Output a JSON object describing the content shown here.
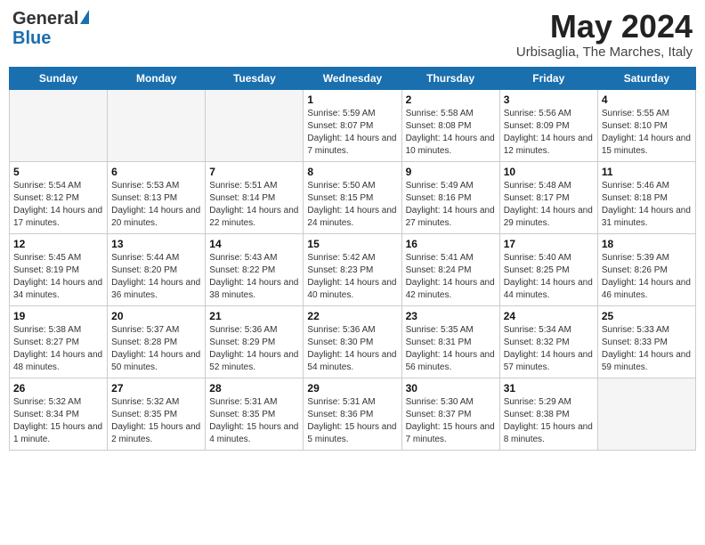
{
  "logo": {
    "general": "General",
    "blue": "Blue"
  },
  "title": {
    "month": "May 2024",
    "location": "Urbisaglia, The Marches, Italy"
  },
  "headers": [
    "Sunday",
    "Monday",
    "Tuesday",
    "Wednesday",
    "Thursday",
    "Friday",
    "Saturday"
  ],
  "weeks": [
    [
      {
        "day": "",
        "empty": true
      },
      {
        "day": "",
        "empty": true
      },
      {
        "day": "",
        "empty": true
      },
      {
        "day": "1",
        "sunrise": "5:59 AM",
        "sunset": "8:07 PM",
        "daylight": "14 hours and 7 minutes."
      },
      {
        "day": "2",
        "sunrise": "5:58 AM",
        "sunset": "8:08 PM",
        "daylight": "14 hours and 10 minutes."
      },
      {
        "day": "3",
        "sunrise": "5:56 AM",
        "sunset": "8:09 PM",
        "daylight": "14 hours and 12 minutes."
      },
      {
        "day": "4",
        "sunrise": "5:55 AM",
        "sunset": "8:10 PM",
        "daylight": "14 hours and 15 minutes."
      }
    ],
    [
      {
        "day": "5",
        "sunrise": "5:54 AM",
        "sunset": "8:12 PM",
        "daylight": "14 hours and 17 minutes."
      },
      {
        "day": "6",
        "sunrise": "5:53 AM",
        "sunset": "8:13 PM",
        "daylight": "14 hours and 20 minutes."
      },
      {
        "day": "7",
        "sunrise": "5:51 AM",
        "sunset": "8:14 PM",
        "daylight": "14 hours and 22 minutes."
      },
      {
        "day": "8",
        "sunrise": "5:50 AM",
        "sunset": "8:15 PM",
        "daylight": "14 hours and 24 minutes."
      },
      {
        "day": "9",
        "sunrise": "5:49 AM",
        "sunset": "8:16 PM",
        "daylight": "14 hours and 27 minutes."
      },
      {
        "day": "10",
        "sunrise": "5:48 AM",
        "sunset": "8:17 PM",
        "daylight": "14 hours and 29 minutes."
      },
      {
        "day": "11",
        "sunrise": "5:46 AM",
        "sunset": "8:18 PM",
        "daylight": "14 hours and 31 minutes."
      }
    ],
    [
      {
        "day": "12",
        "sunrise": "5:45 AM",
        "sunset": "8:19 PM",
        "daylight": "14 hours and 34 minutes."
      },
      {
        "day": "13",
        "sunrise": "5:44 AM",
        "sunset": "8:20 PM",
        "daylight": "14 hours and 36 minutes."
      },
      {
        "day": "14",
        "sunrise": "5:43 AM",
        "sunset": "8:22 PM",
        "daylight": "14 hours and 38 minutes."
      },
      {
        "day": "15",
        "sunrise": "5:42 AM",
        "sunset": "8:23 PM",
        "daylight": "14 hours and 40 minutes."
      },
      {
        "day": "16",
        "sunrise": "5:41 AM",
        "sunset": "8:24 PM",
        "daylight": "14 hours and 42 minutes."
      },
      {
        "day": "17",
        "sunrise": "5:40 AM",
        "sunset": "8:25 PM",
        "daylight": "14 hours and 44 minutes."
      },
      {
        "day": "18",
        "sunrise": "5:39 AM",
        "sunset": "8:26 PM",
        "daylight": "14 hours and 46 minutes."
      }
    ],
    [
      {
        "day": "19",
        "sunrise": "5:38 AM",
        "sunset": "8:27 PM",
        "daylight": "14 hours and 48 minutes."
      },
      {
        "day": "20",
        "sunrise": "5:37 AM",
        "sunset": "8:28 PM",
        "daylight": "14 hours and 50 minutes."
      },
      {
        "day": "21",
        "sunrise": "5:36 AM",
        "sunset": "8:29 PM",
        "daylight": "14 hours and 52 minutes."
      },
      {
        "day": "22",
        "sunrise": "5:36 AM",
        "sunset": "8:30 PM",
        "daylight": "14 hours and 54 minutes."
      },
      {
        "day": "23",
        "sunrise": "5:35 AM",
        "sunset": "8:31 PM",
        "daylight": "14 hours and 56 minutes."
      },
      {
        "day": "24",
        "sunrise": "5:34 AM",
        "sunset": "8:32 PM",
        "daylight": "14 hours and 57 minutes."
      },
      {
        "day": "25",
        "sunrise": "5:33 AM",
        "sunset": "8:33 PM",
        "daylight": "14 hours and 59 minutes."
      }
    ],
    [
      {
        "day": "26",
        "sunrise": "5:32 AM",
        "sunset": "8:34 PM",
        "daylight": "15 hours and 1 minute."
      },
      {
        "day": "27",
        "sunrise": "5:32 AM",
        "sunset": "8:35 PM",
        "daylight": "15 hours and 2 minutes."
      },
      {
        "day": "28",
        "sunrise": "5:31 AM",
        "sunset": "8:35 PM",
        "daylight": "15 hours and 4 minutes."
      },
      {
        "day": "29",
        "sunrise": "5:31 AM",
        "sunset": "8:36 PM",
        "daylight": "15 hours and 5 minutes."
      },
      {
        "day": "30",
        "sunrise": "5:30 AM",
        "sunset": "8:37 PM",
        "daylight": "15 hours and 7 minutes."
      },
      {
        "day": "31",
        "sunrise": "5:29 AM",
        "sunset": "8:38 PM",
        "daylight": "15 hours and 8 minutes."
      },
      {
        "day": "",
        "empty": true
      }
    ]
  ]
}
